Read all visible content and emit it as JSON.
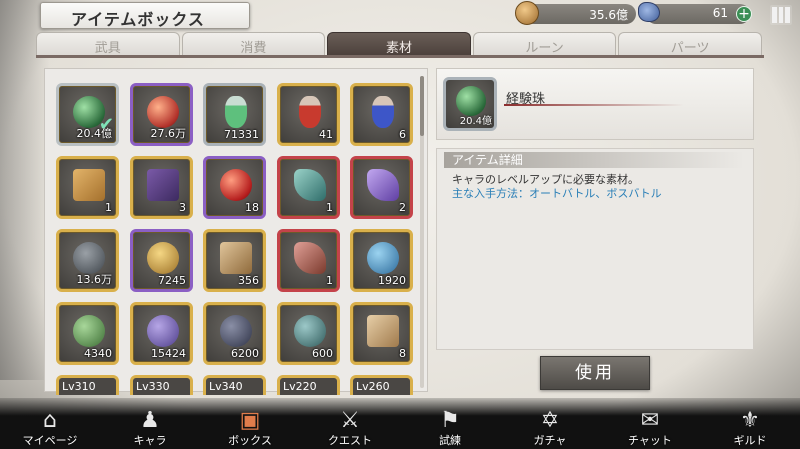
{
  "header": {
    "title": "アイテムボックス",
    "gold": "35.6億",
    "gems": "61"
  },
  "tabs": [
    {
      "label": "武具",
      "active": false
    },
    {
      "label": "消費",
      "active": false
    },
    {
      "label": "素材",
      "active": true
    },
    {
      "label": "ルーン",
      "active": false
    },
    {
      "label": "パーツ",
      "active": false
    }
  ],
  "items": [
    {
      "qty": "20.4億",
      "rarity": "selected",
      "art": "green-orb"
    },
    {
      "qty": "27.6万",
      "rarity": "purple",
      "art": "red-orb"
    },
    {
      "qty": "71331",
      "rarity": "silver",
      "art": "green-potion"
    },
    {
      "qty": "41",
      "rarity": "gold",
      "art": "red-potion"
    },
    {
      "qty": "6",
      "rarity": "gold",
      "art": "blue-potion"
    },
    {
      "qty": "1",
      "rarity": "gold",
      "art": "ticket"
    },
    {
      "qty": "3",
      "rarity": "gold",
      "art": "scroll"
    },
    {
      "qty": "18",
      "rarity": "purple",
      "art": "apple"
    },
    {
      "qty": "1",
      "rarity": "red",
      "art": "leaf"
    },
    {
      "qty": "2",
      "rarity": "red",
      "art": "crystal"
    },
    {
      "qty": "13.6万",
      "rarity": "gold",
      "art": "ore"
    },
    {
      "qty": "7245",
      "rarity": "purple",
      "art": "gold-ore"
    },
    {
      "qty": "356",
      "rarity": "gold",
      "art": "map"
    },
    {
      "qty": "1",
      "rarity": "red",
      "art": "wing"
    },
    {
      "qty": "1920",
      "rarity": "gold",
      "art": "blue-coin"
    },
    {
      "qty": "4340",
      "rarity": "gold",
      "art": "green-medal"
    },
    {
      "qty": "15424",
      "rarity": "gold",
      "art": "purple-medal"
    },
    {
      "qty": "6200",
      "rarity": "gold",
      "art": "dark-medal"
    },
    {
      "qty": "600",
      "rarity": "gold",
      "art": "teal-medal"
    },
    {
      "qty": "8",
      "rarity": "gold",
      "art": "cloth"
    }
  ],
  "level_items": [
    {
      "label": "Lv310"
    },
    {
      "label": "Lv330"
    },
    {
      "label": "Lv340"
    },
    {
      "label": "Lv220"
    },
    {
      "label": "Lv260"
    }
  ],
  "detail": {
    "name": "経験珠",
    "qty": "20.4億",
    "section_title": "アイテム詳細",
    "description": "キャラのレベルアップに必要な素材。",
    "source": "主な入手方法：オートバトル、ボスバトル",
    "use_label": "使用"
  },
  "bottom_nav": [
    {
      "label": "マイページ",
      "icon": "home-icon",
      "glyph": "⌂",
      "active": false
    },
    {
      "label": "キャラ",
      "icon": "characters-icon",
      "glyph": "♟",
      "active": false
    },
    {
      "label": "ボックス",
      "icon": "box-icon",
      "glyph": "▣",
      "active": true
    },
    {
      "label": "クエスト",
      "icon": "crossed-swords-icon",
      "glyph": "⚔",
      "active": false
    },
    {
      "label": "試練",
      "icon": "flag-icon",
      "glyph": "⚑",
      "active": false
    },
    {
      "label": "ガチャ",
      "icon": "star-seal-icon",
      "glyph": "✡",
      "active": false
    },
    {
      "label": "チャット",
      "icon": "chat-icon",
      "glyph": "✉",
      "active": false
    },
    {
      "label": "ギルド",
      "icon": "guild-crest-icon",
      "glyph": "⚜",
      "active": false
    }
  ]
}
